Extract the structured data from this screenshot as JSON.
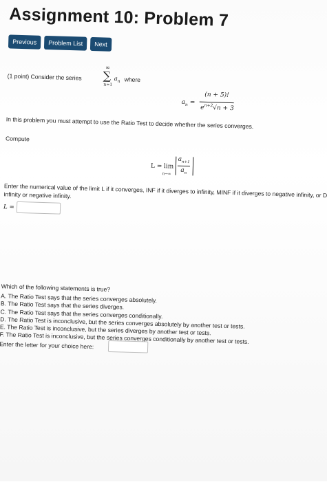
{
  "header": {
    "title": "Assignment 10: Problem 7"
  },
  "nav": {
    "previous": "Previous",
    "problem_list": "Problem List",
    "next": "Next"
  },
  "problem": {
    "intro_prefix": "(1 point) Consider the series",
    "intro_suffix": "where",
    "sum_symbol": "∑",
    "sum_upper": "∞",
    "sum_lower": "n=1",
    "term": "a",
    "term_sub": "n",
    "an_lhs": "a",
    "an_lhs_sub": "n",
    "eq": "=",
    "an_numerator": "(n + 5)!",
    "an_denominator": "e",
    "an_den_exp": "n+2",
    "an_den_rest": "√n + 3",
    "instruction": "In this problem you must attempt to use the Ratio Test to decide whether the series converges.",
    "compute_label": "Compute",
    "L_lhs": "L =",
    "lim": "lim",
    "lim_sub": "n→∞",
    "ratio_num": "a",
    "ratio_num_sub": "n+1",
    "ratio_den": "a",
    "ratio_den_sub": "n",
    "enter_value_line1": "Enter the numerical value of the limit L if it converges, INF if it diverges to infinity, MINF if it diverges to negative infinity, or DIV if it diverges but not to",
    "enter_value_line2": "infinity or negative infinity.",
    "L_input_label": "L =",
    "L_input_value": "",
    "question": "Which of the following statements is true?",
    "options": [
      "A. The Ratio Test says that the series converges absolutely.",
      "B. The Ratio Test says that the series diverges.",
      "C. The Ratio Test says that the series converges conditionally.",
      "D. The Ratio Test is inconclusive, but the series converges absolutely by another test or tests.",
      "E. The Ratio Test is inconclusive, but the series diverges by another test or tests.",
      "F. The Ratio Test is inconclusive, but the series converges conditionally by another test or tests."
    ],
    "choice_label": "Enter the letter for your choice here:",
    "choice_value": ""
  }
}
